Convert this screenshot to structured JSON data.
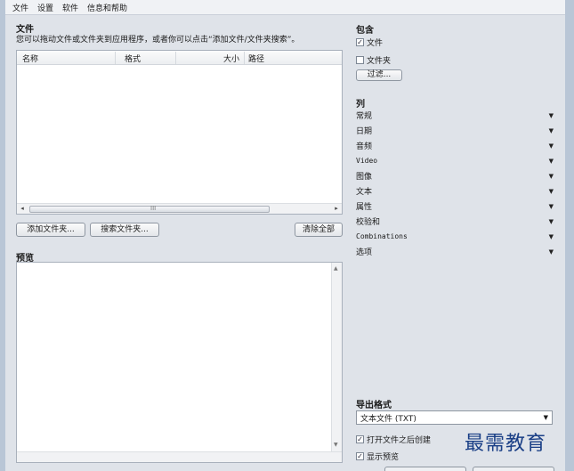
{
  "menu": [
    "文件",
    "设置",
    "软件",
    "信息和帮助"
  ],
  "files": {
    "title": "文件",
    "hint": "您可以拖动文件或文件夹到应用程序，或者你可以点击“添加文件/文件夹搜索”。",
    "columns": [
      "名称",
      "格式",
      "大小",
      "路径"
    ],
    "scroll_grip": "III",
    "scroll_left": "◂",
    "scroll_right": "▸",
    "add_folder_btn": "添加文件夹...",
    "search_folder_btn": "搜索文件夹...",
    "clear_all_btn": "清除全部"
  },
  "preview": {
    "title": "预览"
  },
  "include": {
    "title": "包含",
    "files_label": "文件",
    "files_checked": true,
    "folders_label": "文件夹",
    "folders_checked": false,
    "filter_btn": "过滤..."
  },
  "columns_panel": {
    "title": "列",
    "items": [
      "常规",
      "日期",
      "音频",
      "Video",
      "图像",
      "文本",
      "属性",
      "校验和",
      "Combinations",
      "选项"
    ]
  },
  "export": {
    "title": "导出格式",
    "format_value": "文本文件 (TXT)",
    "open_after_label": "打开文件之后创建",
    "open_after_checked": true,
    "show_preview_label": "显示预览",
    "show_preview_checked": true
  },
  "watermark": "最需教育",
  "icons": {
    "dropdown": "triangle-down",
    "check": "check-mark"
  }
}
